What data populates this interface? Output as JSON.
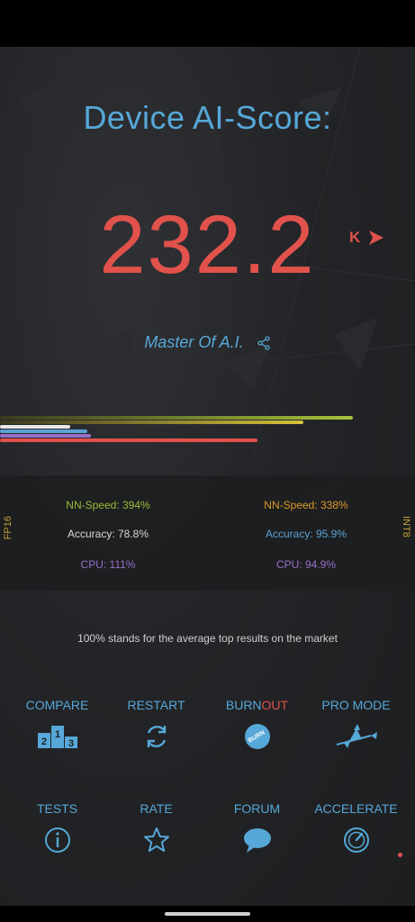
{
  "header": {
    "title": "Device AI-Score:",
    "score": "232.2",
    "k_label": "K",
    "rank": "Master Of A.I."
  },
  "stats": {
    "fp16_label": "FP16",
    "int8_label": "INT8",
    "fp16": {
      "nn_speed": "NN-Speed:  394%",
      "accuracy": "Accuracy:  78.8%",
      "cpu": "CPU:  111%"
    },
    "int8": {
      "nn_speed": "NN-Speed:  338%",
      "accuracy": "Accuracy:  95.9%",
      "cpu": "CPU:  94.9%"
    }
  },
  "bars": {
    "green_level": 0.85,
    "yellow_level": 0.73,
    "red_level": 0.62,
    "white_level": 0.17,
    "blue_level": 0.21,
    "purple_level": 0.22
  },
  "note": "100% stands for the average top results on the market",
  "menu": {
    "compare": "COMPARE",
    "restart": "RESTART",
    "burn_prefix": "BURN",
    "burn_suffix": "OUT",
    "burn_badge": "BURN",
    "pro_mode": "PRO MODE",
    "tests": "TESTS",
    "rate": "RATE",
    "forum": "FORUM",
    "accelerate": "ACCELERATE"
  },
  "colors": {
    "accent_blue": "#56a8d8",
    "score_red": "#e0524b",
    "stat_green": "#9abb3a",
    "stat_orange": "#dc9c2c",
    "stat_purple": "#9a6fc9"
  }
}
